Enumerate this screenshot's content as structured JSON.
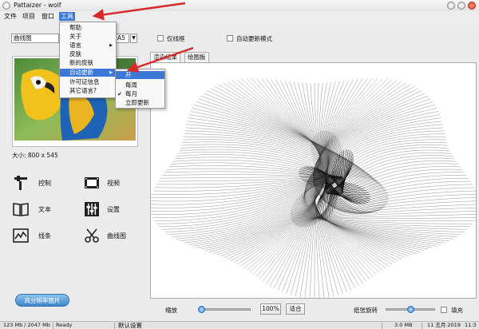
{
  "window": {
    "title": "Pattaizer - wolf"
  },
  "menubar": {
    "file": "文件",
    "project": "项目",
    "window": "窗口",
    "tools": "工具"
  },
  "tools_menu": {
    "help": "帮助",
    "about": "关于",
    "language": "语言",
    "skin": "皮肤",
    "new_skin": "新的皮肤",
    "auto_update": "自动更新",
    "license": "许可证信息",
    "other_languages": "其它语言?"
  },
  "auto_update_menu": {
    "on": "开",
    "weekly": "每周",
    "monthly": "每月",
    "update_now": "立即更新",
    "checked_item": "monthly"
  },
  "toolbar": {
    "type_select": "曲线图",
    "paper_size": "A5",
    "only_lines_label": "仅线框",
    "only_lines_checked": false,
    "auto_update_mode_label": "自动更新模式",
    "auto_update_mode_checked": false
  },
  "tabs": {
    "render_result": "渲染结果",
    "drawing_board": "绘图板"
  },
  "image_panel": {
    "size_label": "大小: 800 x 545"
  },
  "tools": {
    "control": "控制",
    "video": "视频",
    "text": "文本",
    "settings": "设置",
    "lines": "线条",
    "curves": "曲线图"
  },
  "hires_button": "高分辨率图片",
  "zoom": {
    "label": "缩放",
    "value": "100%",
    "fit": "适合",
    "slider_fraction": 0.05
  },
  "rotation": {
    "label": "纸张旋转",
    "slider_fraction": 0.5
  },
  "fill": {
    "label": "填充",
    "checked": false
  },
  "statusbar": {
    "memory": "123 Mb / 2047 Mb",
    "status": "Ready",
    "preset": "默认设置",
    "file_size": "3.0 MB",
    "date": "11 五月 2019",
    "time": "11:3"
  },
  "colors": {
    "accent": "#3b78d8",
    "annotation_arrow": "#d92a2a",
    "button": "#3d86cc"
  },
  "icons": [
    "app-icon",
    "control-icon",
    "video-icon",
    "text-icon",
    "settings-icon",
    "lines-icon",
    "curves-icon"
  ]
}
